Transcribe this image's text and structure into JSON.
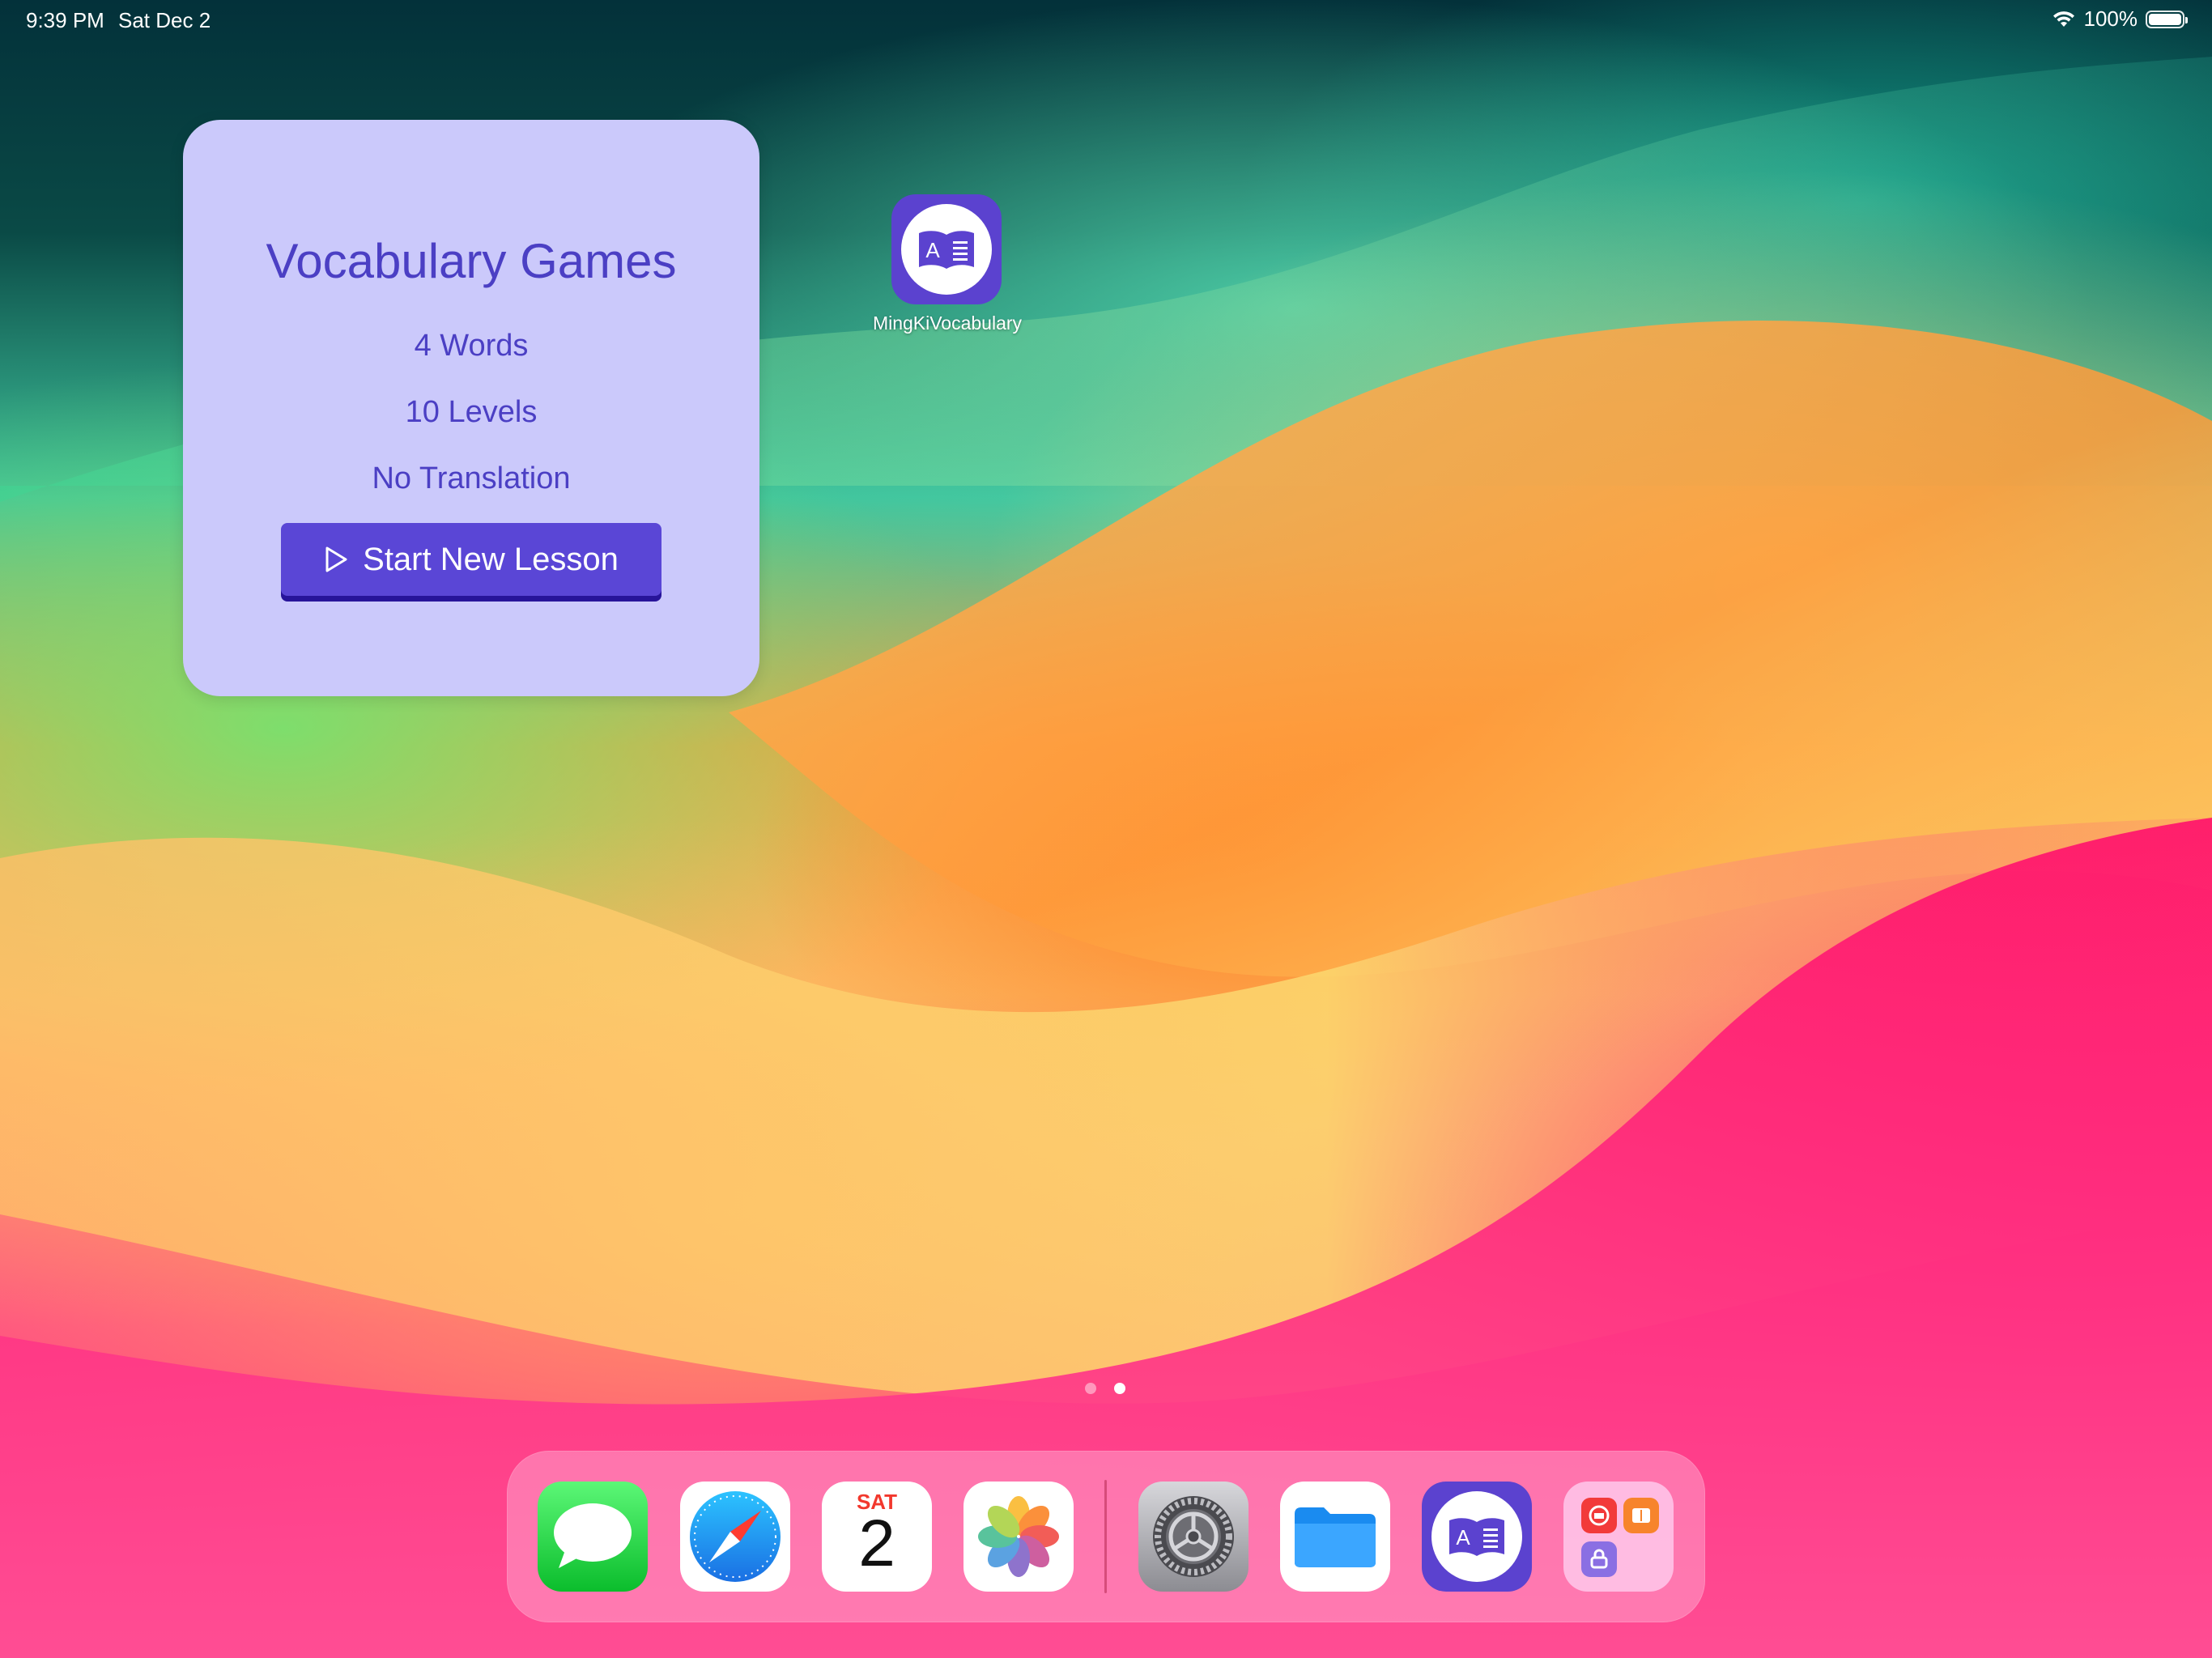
{
  "status_bar": {
    "time": "9:39 PM",
    "date": "Sat Dec 2",
    "battery": "100%"
  },
  "widget": {
    "title": "Vocabulary Games",
    "words": "4 Words",
    "levels": "10 Levels",
    "translation": "No Translation",
    "button_label": "Start New Lesson"
  },
  "home_app": {
    "label": "MingKiVocabulary",
    "icon": "book-icon"
  },
  "page_indicator": {
    "pages": 2,
    "current": 2
  },
  "dock": {
    "apps": [
      {
        "name": "Messages",
        "icon": "messages-icon"
      },
      {
        "name": "Safari",
        "icon": "safari-compass-icon"
      },
      {
        "name": "Calendar",
        "icon": "calendar-icon",
        "day": "SAT",
        "date": "2"
      },
      {
        "name": "Photos",
        "icon": "photos-flower-icon"
      },
      {
        "name": "Settings",
        "icon": "gear-icon"
      },
      {
        "name": "Files",
        "icon": "folder-icon"
      },
      {
        "name": "MingKiVocabulary",
        "icon": "book-icon"
      },
      {
        "name": "App Folder",
        "icon": "app-folder-icon"
      }
    ]
  },
  "colors": {
    "widget_bg": "#cbc9fb",
    "accent": "#5a46d6",
    "accent_dark": "#27149a",
    "text_purple": "#4b3fc4"
  }
}
